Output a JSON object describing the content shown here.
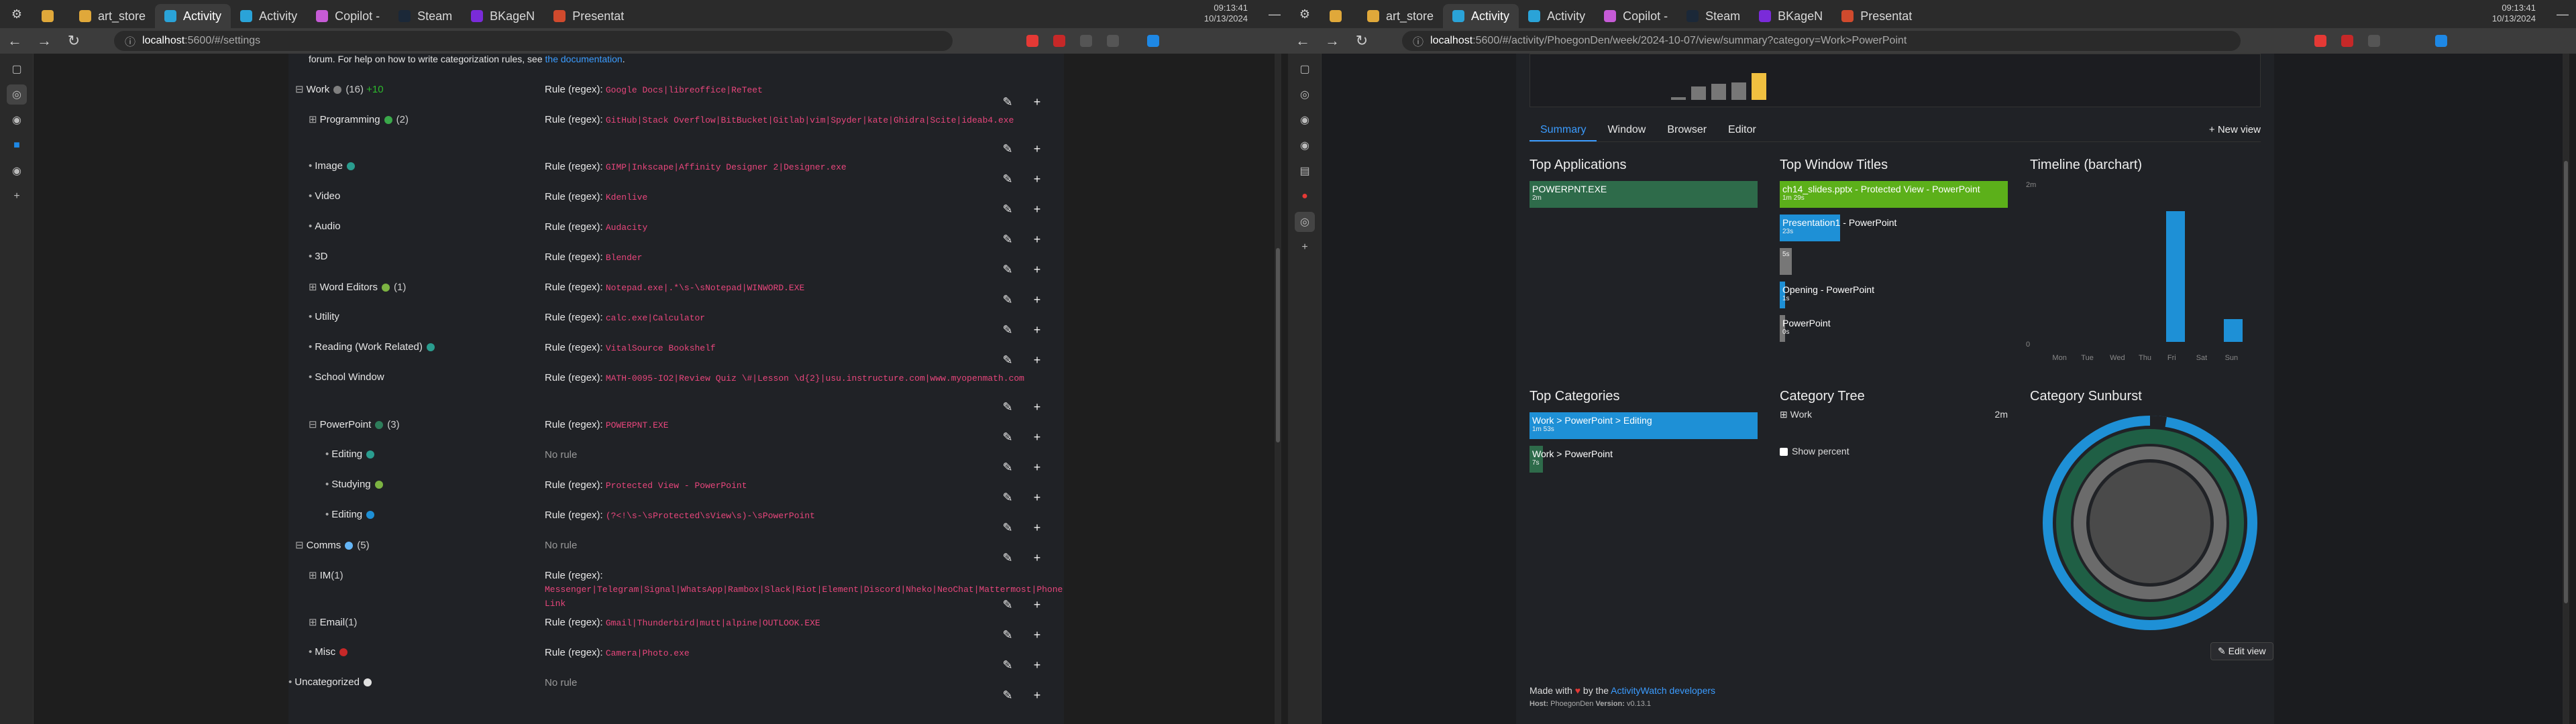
{
  "taskbar": {
    "time": "09:13:41",
    "date": "10/13/2024"
  },
  "left": {
    "tabs": [
      {
        "label": "",
        "color": "#e0a83a"
      },
      {
        "label": "art_store",
        "color": "#e0a83a"
      },
      {
        "label": "Activity",
        "color": "#2aa3d8",
        "active": true
      },
      {
        "label": "Activity",
        "color": "#2aa3d8"
      },
      {
        "label": "Copilot -",
        "color": "#c65bd6"
      },
      {
        "label": "Steam",
        "color": "#1b2838"
      },
      {
        "label": "BKageN",
        "color": "#7a2bd9"
      },
      {
        "label": "Presentat",
        "color": "#d04a2d"
      }
    ],
    "url_host": "localhost",
    "url_path": ":5600/#/settings",
    "forum_text": "forum. For help on how to write categorization rules, see ",
    "forum_link": "the documentation",
    "forum_end": ".",
    "rows": [
      {
        "toggle": "⊟",
        "name": "Work",
        "dot": "#808080",
        "count": "(16)",
        "inc": "+10",
        "indent": 0,
        "rule_label": "Rule (regex):",
        "rule": "Google Docs|libreoffice|ReTeet"
      },
      {
        "toggle": "⊞",
        "name": "Programming",
        "dot": "#3aa84a",
        "count": "(2)",
        "indent": 1,
        "rule_label": "Rule (regex):",
        "rule": "GitHub|Stack Overflow|BitBucket|Gitlab|vim|Spyder|kate|Ghidra|Scite|ideab4.exe",
        "tall": true
      },
      {
        "toggle": "•",
        "name": "Image",
        "dot": "#2a9d8f",
        "indent": 1,
        "rule_label": "Rule (regex):",
        "rule": "GIMP|Inkscape|Affinity Designer 2|Designer.exe"
      },
      {
        "toggle": "•",
        "name": "Video",
        "indent": 1,
        "rule_label": "Rule (regex):",
        "rule": "Kdenlive"
      },
      {
        "toggle": "•",
        "name": "Audio",
        "indent": 1,
        "rule_label": "Rule (regex):",
        "rule": "Audacity"
      },
      {
        "toggle": "•",
        "name": "3D",
        "indent": 1,
        "rule_label": "Rule (regex):",
        "rule": "Blender"
      },
      {
        "toggle": "⊞",
        "name": "Word Editors",
        "dot": "#7cb342",
        "count": "(1)",
        "indent": 1,
        "rule_label": "Rule (regex):",
        "rule": "Notepad.exe|.*\\s-\\sNotepad|WINWORD.EXE"
      },
      {
        "toggle": "•",
        "name": "Utility",
        "indent": 1,
        "rule_label": "Rule (regex):",
        "rule": "calc.exe|Calculator"
      },
      {
        "toggle": "•",
        "name": "Reading (Work Related)",
        "dot": "#2a9d8f",
        "indent": 1,
        "rule_label": "Rule (regex):",
        "rule": "VitalSource Bookshelf"
      },
      {
        "toggle": "•",
        "name": "School Window",
        "indent": 1,
        "rule_label": "Rule (regex):",
        "rule": "MATH-0095-IO2|Review Quiz \\#|Lesson \\d{2}|usu.instructure.com|www.myopenmath.com",
        "tall": true
      },
      {
        "toggle": "⊟",
        "name": "PowerPoint",
        "dot": "#2e7d5b",
        "count": "(3)",
        "indent": 1,
        "rule_label": "Rule (regex):",
        "rule": "POWERPNT.EXE"
      },
      {
        "toggle": "•",
        "name": "Editing",
        "dot": "#2a9d8f",
        "indent": 2,
        "rule_label": "",
        "rule": "",
        "norule": "No rule"
      },
      {
        "toggle": "•",
        "name": "Studying",
        "dot": "#7cb342",
        "indent": 2,
        "rule_label": "Rule (regex):",
        "rule": "Protected View - PowerPoint"
      },
      {
        "toggle": "•",
        "name": "Editing",
        "dot": "#1e90d6",
        "indent": 2,
        "rule_label": "Rule (regex):",
        "rule": "(?<!\\s-\\sProtected\\sView\\s)-\\sPowerPoint"
      },
      {
        "toggle": "⊟",
        "name": "Comms",
        "dot": "#64b5f6",
        "count": "(5)",
        "indent": 0,
        "rule_label": "",
        "rule": "",
        "norule": "No rule"
      },
      {
        "toggle": "⊞",
        "name": "IM",
        "count": "(1)",
        "indent": 1,
        "rule_label": "Rule (regex):",
        "rule": "Messenger|Telegram|Signal|WhatsApp|Rambox|Slack|Riot|Element|Discord|Nheko|NeoChat|Mattermost|Phone Link",
        "tall": true
      },
      {
        "toggle": "⊞",
        "name": "Email",
        "count": "(1)",
        "indent": 1,
        "rule_label": "Rule (regex):",
        "rule": "Gmail|Thunderbird|mutt|alpine|OUTLOOK.EXE"
      },
      {
        "toggle": "•",
        "name": "Misc",
        "dot": "#c62828",
        "indent": 1,
        "rule_label": "Rule (regex):",
        "rule": "Camera|Photo.exe"
      },
      {
        "toggle": "•",
        "name": "Uncategorized",
        "dot": "#e0e0e0",
        "indent": -1,
        "rule_label": "",
        "rule": "",
        "norule": "No rule"
      }
    ]
  },
  "right": {
    "url_host": "localhost",
    "url_path": ":5600/#/activity/PhoegonDen/week/2024-10-07/view/summary?category=Work>PowerPoint",
    "subtabs": [
      "Summary",
      "Window",
      "Browser",
      "Editor"
    ],
    "new_view": "+ New view",
    "sections": {
      "top_apps": "Top Applications",
      "top_titles": "Top Window Titles",
      "timeline": "Timeline (barchart)",
      "top_categories": "Top Categories",
      "category_tree": "Category Tree",
      "category_sunburst": "Category Sunburst"
    },
    "top_apps": [
      {
        "label": "POWERPNT.EXE",
        "dur": "2m"
      }
    ],
    "top_titles": [
      {
        "label": "ch14_slides.pptx - Protected View - PowerPoint",
        "dur": "1m 29s",
        "color": "#5cb01a"
      },
      {
        "label": "Presentation1 - PowerPoint",
        "dur": "23s",
        "color": "#1e90d6"
      },
      {
        "label": "",
        "dur": "5s",
        "color": "#777"
      },
      {
        "label": "Opening - PowerPoint",
        "dur": "1s",
        "color": "#1e90d6"
      },
      {
        "label": "PowerPoint",
        "dur": "0s",
        "color": "#777"
      }
    ],
    "timeline": {
      "y_top": "2m",
      "y_zero": "0",
      "days": [
        "Mon",
        "Tue",
        "Wed",
        "Thu",
        "Fri",
        "Sat",
        "Sun"
      ]
    },
    "top_categories": [
      {
        "label": "Work > PowerPoint > Editing",
        "dur": "1m 53s",
        "color": "#1e90d6"
      },
      {
        "label": "Work > PowerPoint",
        "dur": "7s",
        "color": "#2e6b4a"
      }
    ],
    "tree": {
      "label": "Work",
      "dur": "2m",
      "show_percent": "Show percent"
    },
    "footer": {
      "made_with": "Made with",
      "by": "by the",
      "link": "ActivityWatch developers",
      "host_label": "Host:",
      "host": "PhoegonDen",
      "version_label": "Version:",
      "version": "v0.13.1"
    },
    "edit_view": "Edit view"
  },
  "chart_data": {
    "type": "bar",
    "categories": [
      "Mon",
      "Tue",
      "Wed",
      "Thu",
      "Fri",
      "Sat",
      "Sun"
    ],
    "values": [
      0,
      0,
      0,
      0,
      1.7,
      0,
      0.3
    ],
    "ylim": [
      0,
      2
    ],
    "ylabel": "",
    "xlabel": ""
  }
}
